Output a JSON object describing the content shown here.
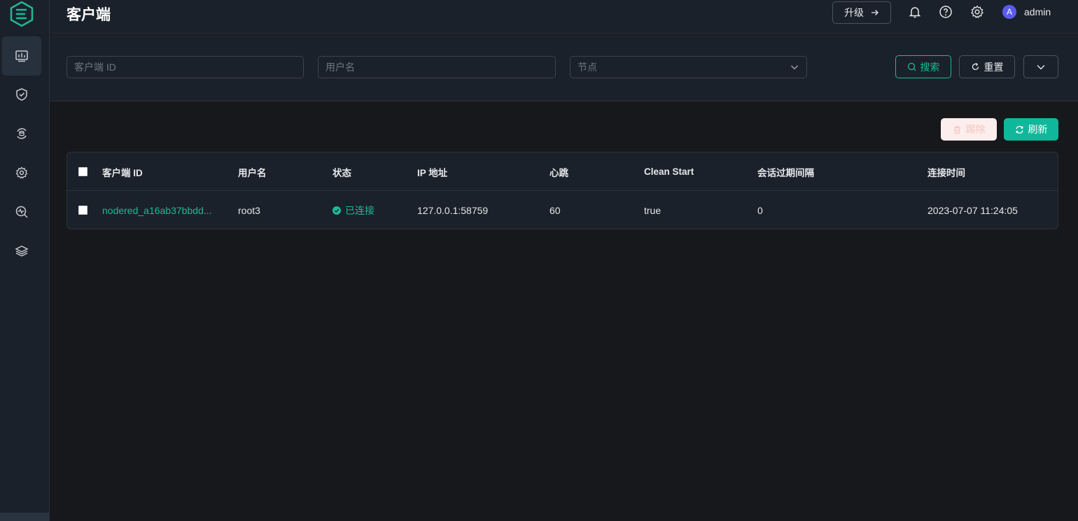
{
  "header": {
    "title": "客户端",
    "upgrade_label": "升级",
    "avatar_letter": "A",
    "username": "admin"
  },
  "filters": {
    "client_id_placeholder": "客户端 ID",
    "username_placeholder": "用户名",
    "node_placeholder": "节点",
    "search_label": "搜索",
    "reset_label": "重置"
  },
  "actions": {
    "kick_label": "踢除",
    "refresh_label": "刷新"
  },
  "table": {
    "columns": [
      "客户端 ID",
      "用户名",
      "状态",
      "IP 地址",
      "心跳",
      "Clean Start",
      "会话过期间隔",
      "连接时间"
    ],
    "rows": [
      {
        "client_id": "nodered_a16ab37bbdd...",
        "username": "root3",
        "status": "已连接",
        "ip": "127.0.0.1:58759",
        "keepalive": "60",
        "clean_start": "true",
        "expiry": "0",
        "connected_at": "2023-07-07 11:24:05"
      }
    ]
  },
  "colors": {
    "accent": "#1fb899",
    "background": "#17181b",
    "panel": "#1b212a"
  }
}
